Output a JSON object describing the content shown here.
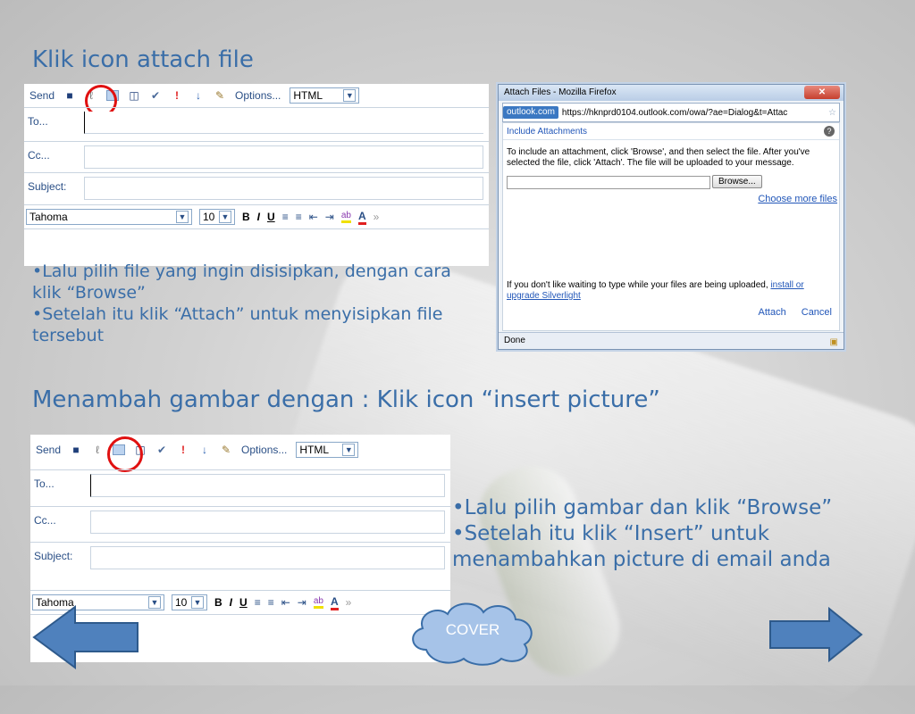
{
  "slide": {
    "heading1": "Klik icon attach file",
    "heading2": "Menambah gambar dengan : Klik icon “insert picture”",
    "bullets1": [
      "•Lalu pilih file yang ingin disisipkan, dengan cara",
      "klik “Browse”",
      "•Setelah itu klik “Attach” untuk menyisipkan file",
      "tersebut"
    ],
    "bullets2": [
      "•Lalu pilih gambar dan klik “Browse”",
      "•Setelah itu klik “Insert” untuk",
      "menambahkan picture di email anda"
    ],
    "cover_label": "COVER",
    "colors": {
      "heading": "#3a6ea8",
      "arrow": "#4f81bd",
      "cloud": "#a6c3e8",
      "highlight": "#e01010"
    }
  },
  "compose": {
    "send": "Send",
    "options": "Options...",
    "format": "HTML",
    "to": "To...",
    "cc": "Cc...",
    "subject": "Subject:",
    "font": "Tahoma",
    "size": "10",
    "bold": "B",
    "italic": "I",
    "underline": "U",
    "icons": [
      "save-icon",
      "attach-icon",
      "insert-picture-icon",
      "address-book-icon",
      "check-names-icon",
      "high-importance-icon",
      "low-importance-icon",
      "signature-icon"
    ]
  },
  "dialog": {
    "title": "Attach Files - Mozilla Firefox",
    "site": "outlook.com",
    "url": "https://hknprd0104.outlook.com/owa/?ae=Dialog&t=Attac",
    "section": "Include Attachments",
    "instructions": "To include an attachment, click 'Browse', and then select the file. After you've selected the file, click 'Attach'. The file will be uploaded to your message.",
    "browse": "Browse...",
    "choose_more": "Choose more files",
    "silverlight_text": "If you don't like waiting to type while your files are being uploaded,",
    "silverlight_link": "install or upgrade Silverlight",
    "attach": "Attach",
    "cancel": "Cancel",
    "status": "Done"
  }
}
